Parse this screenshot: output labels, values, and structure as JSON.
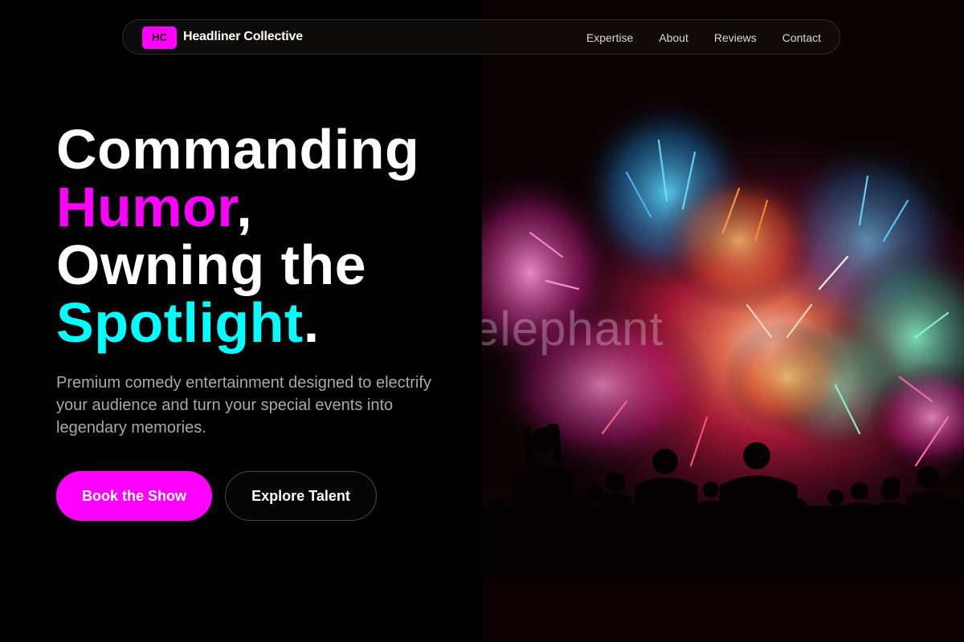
{
  "nav": {
    "logo_initials": "HC",
    "brand_name": "Headliner Collective",
    "links": [
      {
        "label": "Expertise"
      },
      {
        "label": "About"
      },
      {
        "label": "Reviews"
      },
      {
        "label": "Contact"
      }
    ]
  },
  "hero": {
    "headline": {
      "line1": "Commanding",
      "line2_accent": "Humor",
      "line2_rest": ",",
      "line3": "Owning the",
      "line4_accent": "Spotlight",
      "line4_rest": "."
    },
    "subtitle": "Premium comedy entertainment designed to electrify your audience and turn your special events into legendary memories.",
    "primary_button": "Book the Show",
    "secondary_button": "Explore Talent",
    "image_watermark": "elephant"
  },
  "colors": {
    "accent_magenta": "#ff00ff",
    "accent_cyan": "#00ffff",
    "background": "#000000"
  },
  "icons": {
    "hero_image": "fireworks-crowd-photo"
  }
}
